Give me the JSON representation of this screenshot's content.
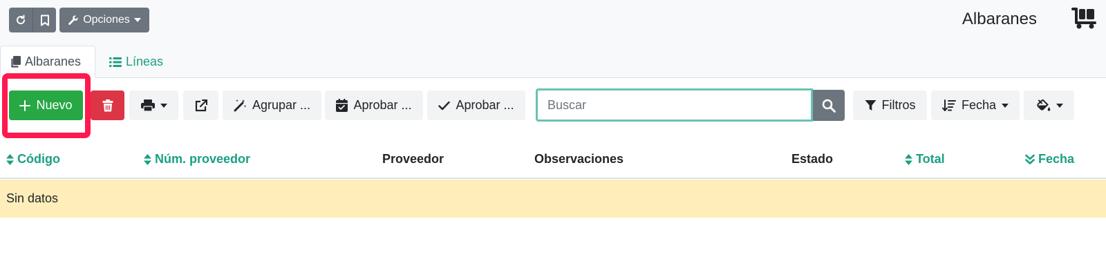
{
  "header": {
    "title": "Albaranes",
    "options_label": "Opciones",
    "title_icon": "dolly-cart-icon",
    "buttons_icons": [
      "reload-icon",
      "bookmark-icon",
      "wrench-icon"
    ]
  },
  "tabs": [
    {
      "label": "Albaranes",
      "icon": "copy-icon",
      "active": true
    },
    {
      "label": "Líneas",
      "icon": "list-icon",
      "active": false
    }
  ],
  "toolbar": {
    "new_label": "Nuevo",
    "group_label": "Agrupar ...",
    "approve1_label": "Aprobar ...",
    "approve2_label": "Aprobar ...",
    "filters_label": "Filtros",
    "sort_label": "Fecha"
  },
  "search": {
    "placeholder": "Buscar",
    "value": ""
  },
  "table": {
    "columns": [
      "Código",
      "Núm. proveedor",
      "Proveedor",
      "Observaciones",
      "Estado",
      "Total",
      "Fecha"
    ],
    "empty_text": "Sin datos"
  },
  "colors": {
    "accent": "#1aa082",
    "new_button": "#28a745",
    "delete_button": "#dc3545",
    "empty_row": "#ffeeba",
    "highlight": "#ff1a4e"
  }
}
